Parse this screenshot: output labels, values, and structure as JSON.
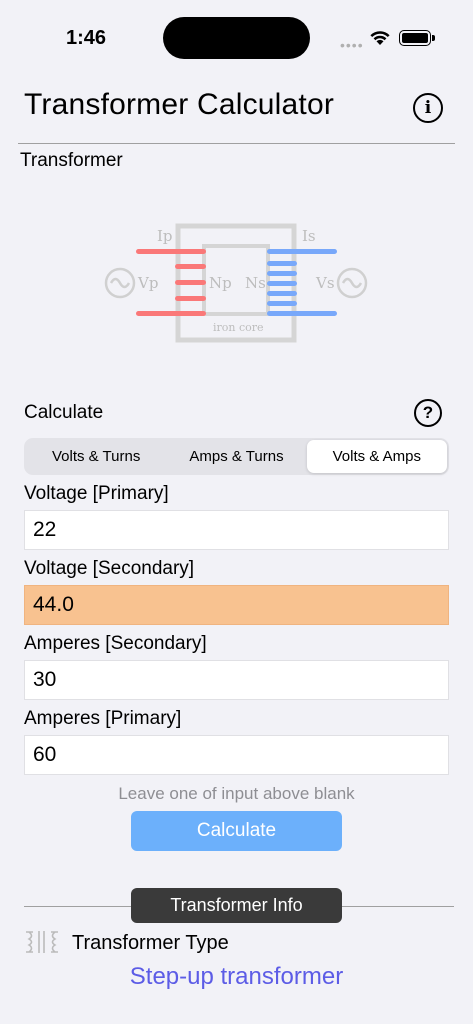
{
  "status": {
    "time": "1:46"
  },
  "header": {
    "title": "Transformer Calculator",
    "info_icon": "info-circle-icon"
  },
  "section_title": "Transformer",
  "diagram": {
    "labels": {
      "ip": "Ip",
      "is": "Is",
      "vp": "Vp",
      "vs": "Vs",
      "np": "Np",
      "ns": "Ns",
      "core": "iron core"
    },
    "colors": {
      "primary": "#fa7878",
      "secondary": "#78a8fa",
      "core": "#d0d0d0",
      "text": "#bdbdbd"
    }
  },
  "calculate": {
    "label": "Calculate",
    "help_icon": "question-circle-icon",
    "help_glyph": "?",
    "tabs": [
      "Volts & Turns",
      "Amps & Turns",
      "Volts & Amps"
    ],
    "active_tab": "Volts & Amps"
  },
  "fields": [
    {
      "label": "Voltage [Primary]",
      "value": "22"
    },
    {
      "label": "Voltage [Secondary]",
      "value": "44.0"
    },
    {
      "label": "Amperes [Secondary]",
      "value": "30"
    },
    {
      "label": "Amperes [Primary]",
      "value": "60"
    }
  ],
  "hint": "Leave one of input above blank",
  "calculate_button": "Calculate",
  "info": {
    "tab_label": "Transformer Info",
    "type_label": "Transformer Type",
    "type_value": "Step-up transformer"
  },
  "colors": {
    "result_field": "#f8c290",
    "button": "#6cb0fb",
    "type_value": "#5c5ce6"
  }
}
